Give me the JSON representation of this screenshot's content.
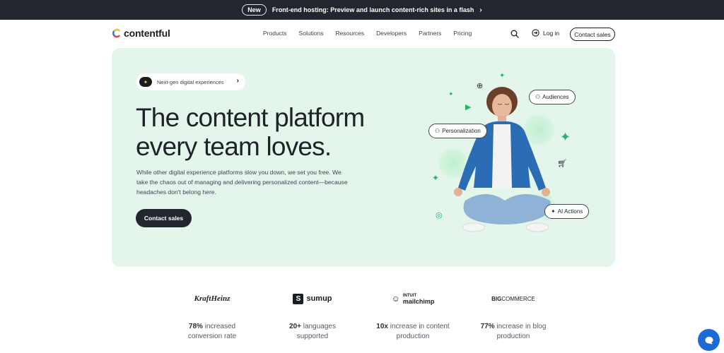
{
  "announcement": {
    "pill": "New",
    "message": "Front-end hosting: Preview and launch content-rich sites in a flash",
    "chevron": "›"
  },
  "nav": {
    "logo_text": "contentful",
    "items": [
      "Products",
      "Solutions",
      "Resources",
      "Developers",
      "Partners",
      "Pricing"
    ],
    "search_icon": "search-icon",
    "login_label": "Log in",
    "contact_label": "Contact sales"
  },
  "hero": {
    "badge_text": "Next-gen digital experiences",
    "headline_line1": "The content platform",
    "headline_line2": "every team loves.",
    "subtext": "While other digital experience platforms slow you down, we set you free. We take the chaos out of managing and delivering personalized content—because headaches don't belong here.",
    "cta_label": "Contact sales",
    "tags": {
      "audiences": "Audiences",
      "personalization": "Personalization",
      "ai_actions": "AI Actions"
    }
  },
  "stats": [
    {
      "brand": "KraftHeinz",
      "highlight": "78%",
      "rest1": " increased",
      "line2": "conversion rate"
    },
    {
      "brand": "sumup",
      "highlight": "20+",
      "rest1": " languages",
      "line2": "supported"
    },
    {
      "brand": "mailchimp",
      "brand_top": "INTUIT",
      "highlight": "10x",
      "rest1": " increase in content",
      "line2": "production"
    },
    {
      "brand": "COMMERCE",
      "brand_prefix": "BIG",
      "highlight": "77%",
      "rest1": " increase in blog",
      "line2": "production"
    }
  ],
  "colors": {
    "hero_bg": "#e4f6ec",
    "dark": "#23262e",
    "accent_green": "#1fb866",
    "chat_blue": "#1c6bd4"
  }
}
